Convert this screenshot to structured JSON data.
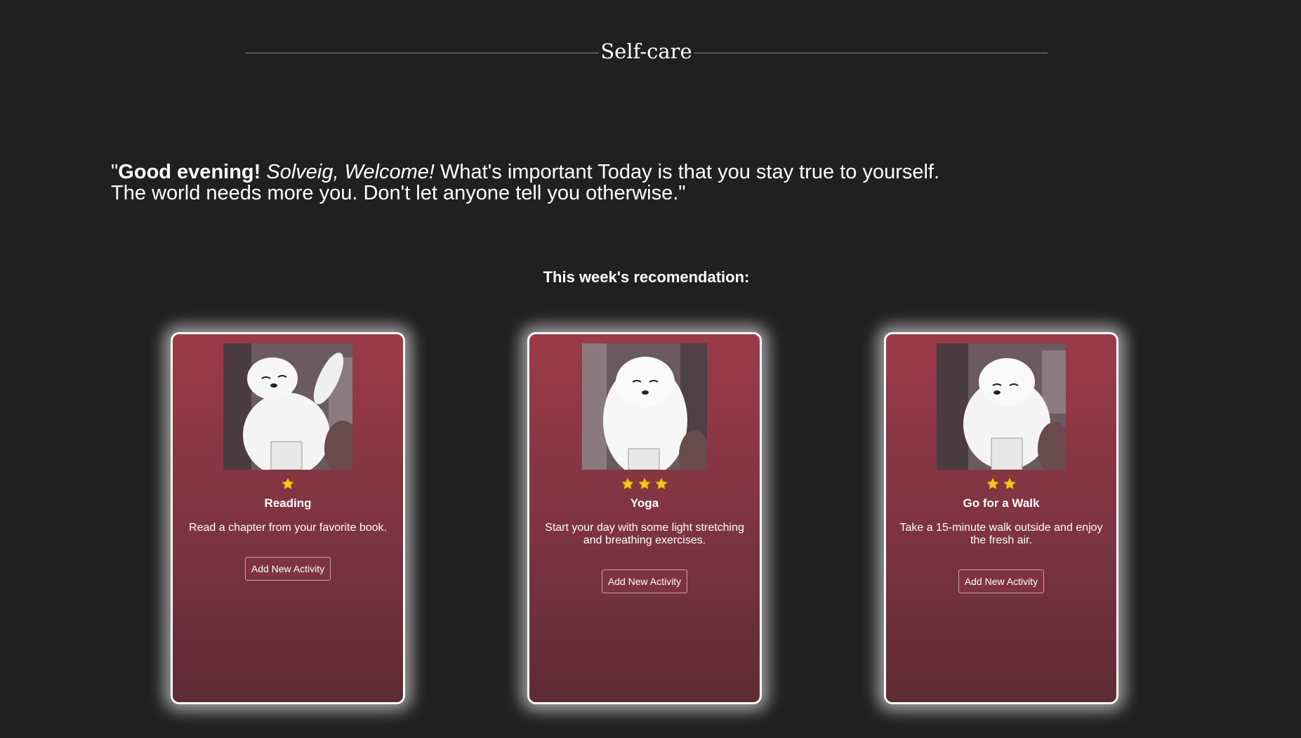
{
  "header": {
    "title": "Self-care"
  },
  "greeting": {
    "open_quote": "\"",
    "salutation": "Good evening!",
    "name_welcome": "Solveig, Welcome!",
    "line1_rest": " What's important Today is that you stay true to yourself.",
    "line2": "The world needs more you. Don't let anyone tell you otherwise.\""
  },
  "recommendations": {
    "heading": "This week's recomendation:",
    "cards": [
      {
        "rating": 1,
        "title": "Reading",
        "description": "Read a chapter from your favorite book.",
        "button_label": "Add New Activity"
      },
      {
        "rating": 3,
        "title": "Yoga",
        "description": "Start your day with some light stretching and breathing exercises.",
        "button_label": "Add New Activity"
      },
      {
        "rating": 2,
        "title": "Go for a Walk",
        "description": "Take a 15-minute walk outside and enjoy the fresh air.",
        "button_label": "Add New Activity"
      }
    ]
  },
  "colors": {
    "background": "#202020",
    "card_top": "#9c3a48",
    "card_bottom": "#5e2b35",
    "star": "#f5c518"
  },
  "icons": {
    "rating": "star-icon",
    "card_image": "polar-bear-illustration"
  }
}
